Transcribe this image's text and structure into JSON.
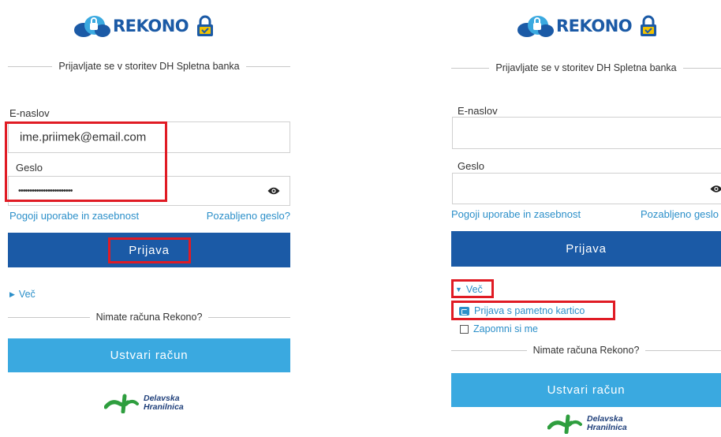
{
  "brand": {
    "name": "REKONO"
  },
  "colors": {
    "primary": "#1b5aa6",
    "secondary": "#3aa9e0",
    "link": "#2b8fc9",
    "highlight": "#e01b24"
  },
  "left": {
    "heading": "Prijavljate se v storitev DH Spletna banka",
    "email_label": "E-naslov",
    "email_value": "ime.priimek@email.com",
    "password_label": "Geslo",
    "password_value": "••••••••••••••••••••••••",
    "terms_link": "Pogoji uporabe in zasebnost",
    "forgot_link": "Pozabljeno geslo?",
    "login_button": "Prijava",
    "more_label": "Več",
    "no_account": "Nimate računa Rekono?",
    "create_button": "Ustvari račun"
  },
  "right": {
    "heading": "Prijavljate se v storitev DH Spletna banka",
    "email_label": "E-naslov",
    "email_value": "",
    "password_label": "Geslo",
    "password_value": "",
    "terms_link": "Pogoji uporabe in zasebnost",
    "forgot_link": "Pozabljeno geslo",
    "login_button": "Prijava",
    "more_label": "Več",
    "smartcard_link": "Prijava s pametno kartico",
    "remember_label": "Zapomni si me",
    "no_account": "Nimate računa Rekono?",
    "create_button": "Ustvari račun"
  },
  "footer_logo": {
    "line1": "Delavska",
    "line2": "Hranilnica"
  }
}
